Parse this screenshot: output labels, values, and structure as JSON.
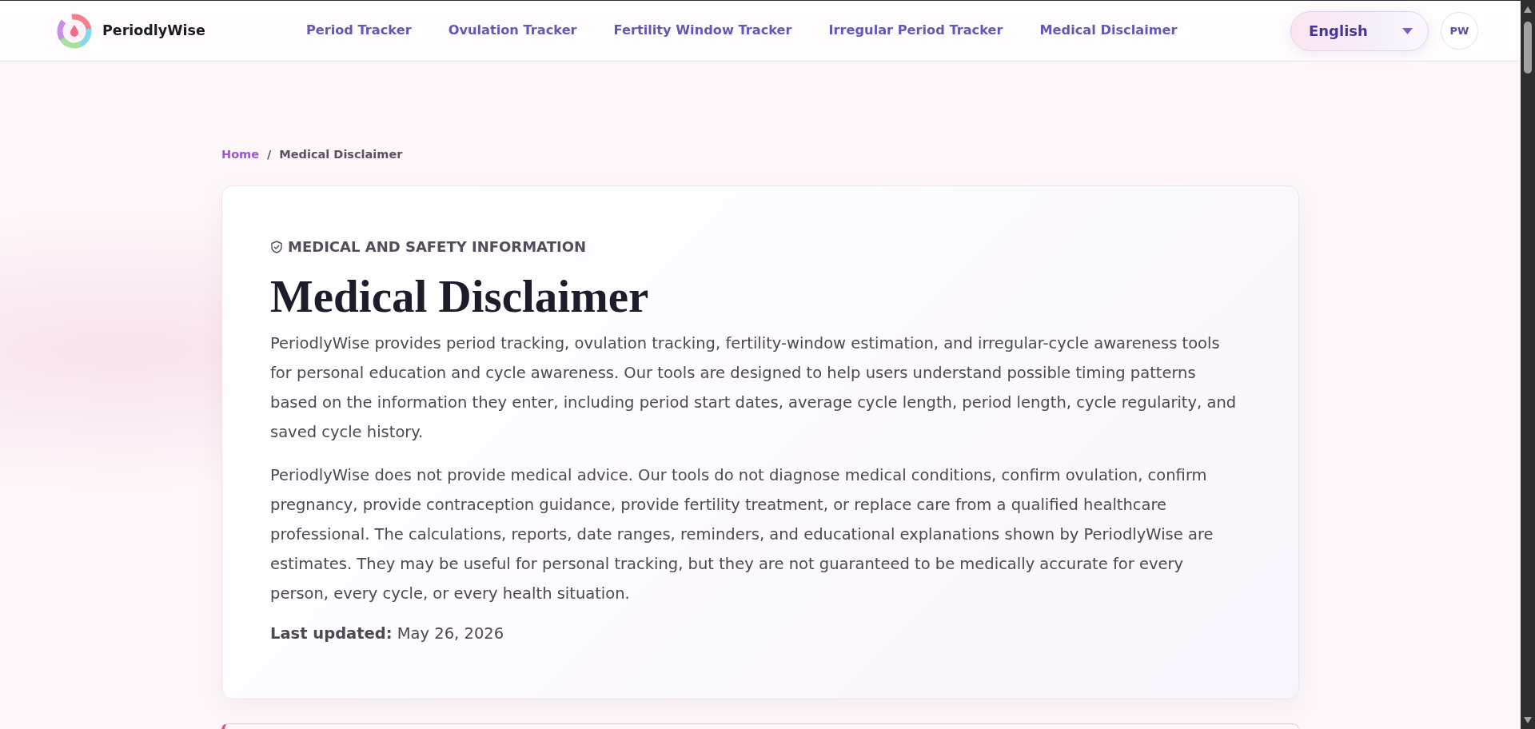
{
  "header": {
    "brand": "PeriodlyWise",
    "nav": [
      "Period Tracker",
      "Ovulation Tracker",
      "Fertility Window Tracker",
      "Irregular Period Tracker",
      "Medical Disclaimer"
    ],
    "language_select": {
      "value": "English"
    },
    "avatar": {
      "initials": "PW"
    }
  },
  "breadcrumb": {
    "items": [
      {
        "label": "Home",
        "kind": "link"
      },
      {
        "label": "Medical Disclaimer",
        "kind": "current"
      }
    ],
    "separator": "/"
  },
  "disclaimer_card": {
    "eyebrow": "MEDICAL AND SAFETY INFORMATION",
    "title": "Medical Disclaimer",
    "paragraphs": [
      "PeriodlyWise provides period tracking, ovulation tracking, fertility-window estimation, and irregular-cycle awareness tools for personal education and cycle awareness. Our tools are designed to help users understand possible timing patterns based on the information they enter, including period start dates, average cycle length, period length, cycle regularity, and saved cycle history.",
      "PeriodlyWise does not provide medical advice. Our tools do not diagnose medical conditions, confirm ovulation, confirm pregnancy, provide contraception guidance, provide fertility treatment, or replace care from a qualified healthcare professional. The calculations, reports, date ranges, reminders, and educational explanations shown by PeriodlyWise are estimates. They may be useful for personal tracking, but they are not guaranteed to be medically accurate for every person, every cycle, or every health situation."
    ],
    "last_updated": "**Last updated:** May 26, 2026"
  }
}
